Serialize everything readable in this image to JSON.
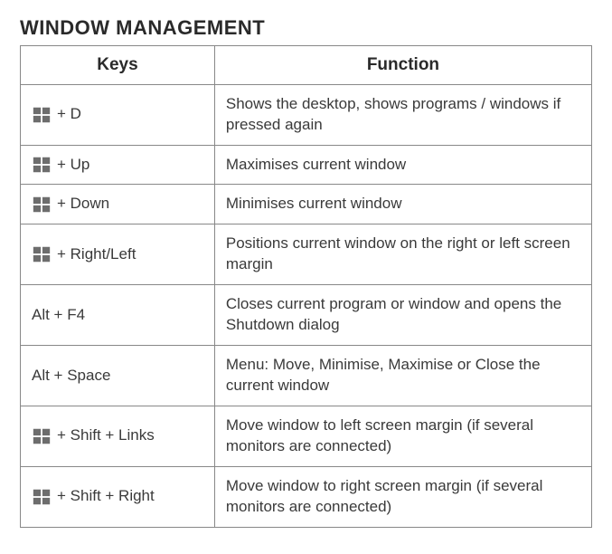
{
  "title": "WINDOW MANAGEMENT",
  "headers": {
    "keys": "Keys",
    "function": "Function"
  },
  "icons": {
    "windows": "windows-logo-icon"
  },
  "rows": [
    {
      "has_winkey": true,
      "keys_text": "+ D",
      "function": "Shows the desktop, shows programs / windows if pressed again"
    },
    {
      "has_winkey": true,
      "keys_text": "+ Up",
      "function": "Maximises current window"
    },
    {
      "has_winkey": true,
      "keys_text": "+ Down",
      "function": "Minimises current window"
    },
    {
      "has_winkey": true,
      "keys_text": "+ Right/Left",
      "function": "Positions current window on the right or left screen margin"
    },
    {
      "has_winkey": false,
      "keys_text": "Alt + F4",
      "function": "Closes current program or window and opens the Shutdown dialog"
    },
    {
      "has_winkey": false,
      "keys_text": "Alt + Space",
      "function": "Menu: Move, Minimise, Maximise or Close the current window"
    },
    {
      "has_winkey": true,
      "keys_text": "+ Shift + Links",
      "function": "Move window to left screen margin (if several monitors are connected)"
    },
    {
      "has_winkey": true,
      "keys_text": "+ Shift + Right",
      "function": "Move window to right screen margin (if several monitors are connected)"
    }
  ],
  "colors": {
    "win_icon": "#6d6d6d",
    "border": "#888888",
    "text": "#3a3a3a"
  }
}
